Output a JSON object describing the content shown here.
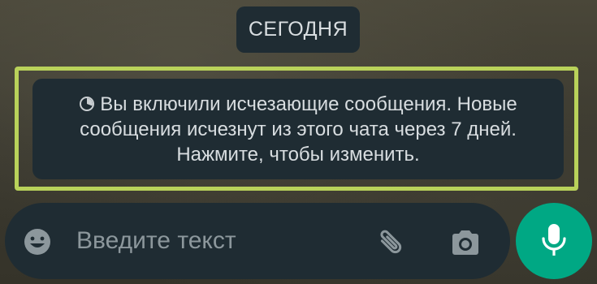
{
  "chat": {
    "date_label": "СЕГОДНЯ",
    "notice": {
      "icon": "disappearing-timer-icon",
      "line1": "Вы включили исчезающие сообщения. Новые",
      "line2": "сообщения исчезнут из этого чата через 7 дней.",
      "line3": "Нажмите, чтобы изменить."
    }
  },
  "composer": {
    "placeholder": "Введите текст",
    "value": "",
    "icons": [
      "emoji-icon",
      "paperclip-icon",
      "camera-icon",
      "microphone-icon"
    ]
  },
  "colors": {
    "bubble": "#1f2c33",
    "highlight": "#b9d25a",
    "accent": "#00a884",
    "text": "#d8dde0",
    "placeholder": "#8c979c"
  }
}
